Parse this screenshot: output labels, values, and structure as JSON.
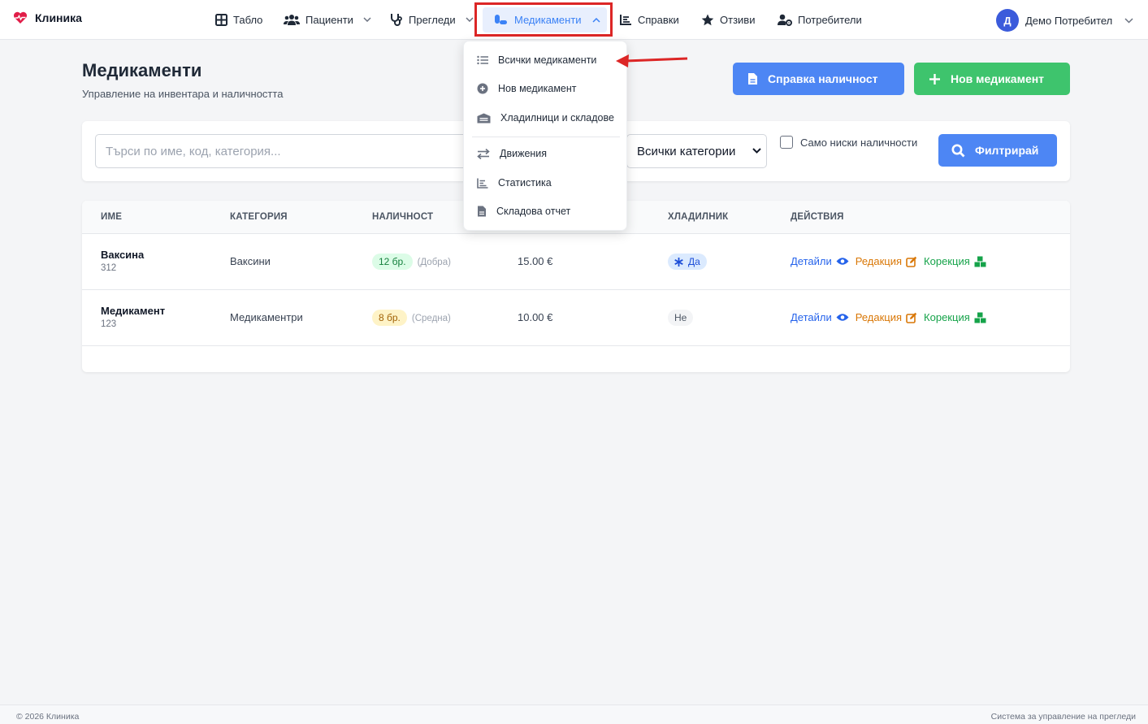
{
  "brand": {
    "name": "Клиника"
  },
  "nav": {
    "dashboard": "Табло",
    "patients": "Пациенти",
    "exams": "Прегледи",
    "medicines": "Медикаменти",
    "reports": "Справки",
    "reviews": "Отзиви",
    "users": "Потребители"
  },
  "user": {
    "initial": "Д",
    "name": "Демо Потребител"
  },
  "page": {
    "title": "Медикаменти",
    "subtitle": "Управление на инвентара и наличността"
  },
  "buttons": {
    "stock_report": "Справка наличност",
    "new_medicine": "Нов медикамент",
    "filter": "Филтрирай"
  },
  "filters": {
    "search_placeholder": "Търси по име, код, категория...",
    "category_selected": "Всички категории",
    "low_stock_label": "Само ниски наличности"
  },
  "table": {
    "headers": [
      "ИМЕ",
      "КАТЕГОРИЯ",
      "НАЛИЧНОСТ",
      "ХЛАДИЛНИК",
      "ДЕЙСТВИЯ"
    ],
    "action_labels": {
      "details": "Детайли",
      "edit": "Редакция",
      "correct": "Корекция"
    },
    "rows": [
      {
        "name": "Ваксина",
        "code": "312",
        "category": "Ваксини",
        "stock": "12 бр.",
        "stock_note": "(Добра)",
        "price": "15.00 €",
        "fridge": "Да"
      },
      {
        "name": "Медикамент",
        "code": "123",
        "category": "Медикаментри",
        "stock": "8 бр.",
        "stock_note": "(Средна)",
        "price": "10.00 €",
        "fridge": "Не"
      }
    ]
  },
  "dropdown": {
    "items": [
      "Всички медикаменти",
      "Нов медикамент",
      "Хладилници и складове",
      "Движения",
      "Статистика",
      "Складова отчет"
    ]
  },
  "footer": {
    "left": "© 2026 Клиника",
    "right": "Система за управление на прегледи"
  },
  "colors": {
    "primary": "#4d86f4",
    "success": "#3ec46d",
    "highlight": "#dc2626",
    "stock_good_bg": "#dcfce7",
    "stock_medium_bg": "#fef3c7"
  }
}
